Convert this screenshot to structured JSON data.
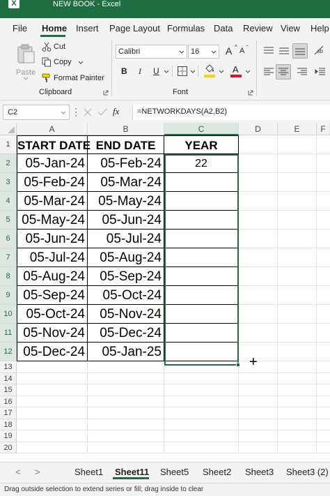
{
  "app": {
    "title": "NEW BOOK - Excel",
    "logo_letter": "X"
  },
  "menu": {
    "items": [
      "File",
      "Home",
      "Insert",
      "Page Layout",
      "Formulas",
      "Data",
      "Review",
      "View",
      "Help"
    ],
    "active": "Home"
  },
  "ribbon": {
    "clipboard": {
      "paste": "Paste",
      "cut": "Cut",
      "copy": "Copy",
      "format_painter": "Format Painter",
      "group_label": "Clipboard"
    },
    "font": {
      "font_name": "Calibri",
      "font_size": "16",
      "grow": "A",
      "shrink": "A",
      "bold": "B",
      "italic": "I",
      "underline": "U",
      "highlight": "ab",
      "font_color": "A",
      "group_label": "Font",
      "accent_highlight": "#ffd400",
      "accent_font_color": "#e81123"
    }
  },
  "formula_bar": {
    "name_box": "C2",
    "fx": "fx",
    "formula": "=NETWORKDAYS(A2,B2)"
  },
  "columns": [
    "A",
    "B",
    "C",
    "D",
    "E",
    "F"
  ],
  "rows": [
    "1",
    "2",
    "3",
    "4",
    "5",
    "6",
    "7",
    "8",
    "9",
    "10",
    "11",
    "12",
    "13",
    "14",
    "15",
    "16",
    "17",
    "18",
    "19",
    "20"
  ],
  "table": {
    "headers": [
      "START DATE",
      "END DATE",
      "YEAR"
    ],
    "rows": [
      [
        "05-Jan-24",
        "05-Feb-24",
        "22"
      ],
      [
        "05-Feb-24",
        "05-Mar-24",
        ""
      ],
      [
        "05-Mar-24",
        "05-May-24",
        ""
      ],
      [
        "05-May-24",
        "05-Jun-24",
        ""
      ],
      [
        "05-Jun-24",
        "05-Jul-24",
        ""
      ],
      [
        "05-Jul-24",
        "05-Aug-24",
        ""
      ],
      [
        "05-Aug-24",
        "05-Sep-24",
        ""
      ],
      [
        "05-Sep-24",
        "05-Oct-24",
        ""
      ],
      [
        "05-Oct-24",
        "05-Nov-24",
        ""
      ],
      [
        "05-Nov-24",
        "05-Dec-24",
        ""
      ],
      [
        "05-Dec-24",
        "05-Jan-25",
        ""
      ]
    ]
  },
  "sheets": {
    "tabs": [
      "Sheet1",
      "Sheet11",
      "Sheet5",
      "Sheet2",
      "Sheet3",
      "Sheet3 (2)"
    ],
    "active": "Sheet11",
    "prev": "<",
    "next": ">"
  },
  "status": {
    "text": "Drag outside selection to extend series or fill; drag inside to clear"
  },
  "colors": {
    "accent": "#1e6e42"
  }
}
